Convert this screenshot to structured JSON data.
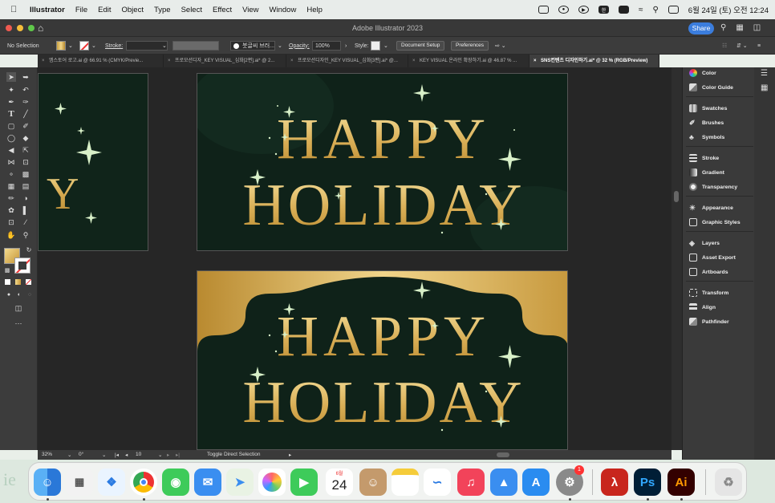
{
  "menubar": {
    "app_name": "Illustrator",
    "items": [
      "File",
      "Edit",
      "Object",
      "Type",
      "Select",
      "Effect",
      "View",
      "Window",
      "Help"
    ],
    "datetime": "6월 24일 (토) 오전 12:24"
  },
  "titlebar": {
    "title": "Adobe Illustrator 2023",
    "share_label": "Share"
  },
  "controlbar": {
    "selection": "No Selection",
    "stroke_label": "Stroke:",
    "brush_label": "붓글씨 브러...",
    "opacity_label": "Opacity:",
    "opacity_value": "100%",
    "style_label": "Style:",
    "document_setup": "Document Setup",
    "preferences": "Preferences"
  },
  "tabs": [
    "엠스토어 로고.ai @ 66.91 % (CMYK/Previe...",
    "프로모션디자_KEY VISUAL_심화[2편].ai* @ 2...",
    "프로모션디자인_KEY VISUAL_심화[3편].ai* @...",
    "KEY VISUAL 온라인 확장하기.ai @ 46.87 % ...",
    "SNS컨텐츠 디자인하기.ai* @ 32 % (RGB/Preview)"
  ],
  "artwork": {
    "line1": "HAPPY",
    "line2": "HOLIDAY",
    "partial_letter": "Y",
    "gold": "#d9b35a"
  },
  "panels": [
    {
      "label": "Color",
      "icon": "color-icon"
    },
    {
      "label": "Color Guide",
      "icon": "color-guide-icon"
    },
    {
      "label": "Swatches",
      "icon": "swatches-icon"
    },
    {
      "label": "Brushes",
      "icon": "brushes-icon"
    },
    {
      "label": "Symbols",
      "icon": "symbols-icon"
    },
    {
      "label": "Stroke",
      "icon": "stroke-icon"
    },
    {
      "label": "Gradient",
      "icon": "gradient-icon"
    },
    {
      "label": "Transparency",
      "icon": "transparency-icon"
    },
    {
      "label": "Appearance",
      "icon": "appearance-icon"
    },
    {
      "label": "Graphic Styles",
      "icon": "graphic-styles-icon"
    },
    {
      "label": "Layers",
      "icon": "layers-icon"
    },
    {
      "label": "Asset Export",
      "icon": "asset-export-icon"
    },
    {
      "label": "Artboards",
      "icon": "artboards-icon"
    },
    {
      "label": "Transform",
      "icon": "transform-icon"
    },
    {
      "label": "Align",
      "icon": "align-icon"
    },
    {
      "label": "Pathfinder",
      "icon": "pathfinder-icon"
    }
  ],
  "status": {
    "zoom": "32%",
    "rotation": "0°",
    "artboard": "10",
    "tool_hint": "Toggle Direct Selection"
  },
  "dock": {
    "calendar_month": "6월",
    "calendar_day": "24",
    "settings_badge": "1",
    "ps_label": "Ps",
    "ai_label": "Ai"
  }
}
